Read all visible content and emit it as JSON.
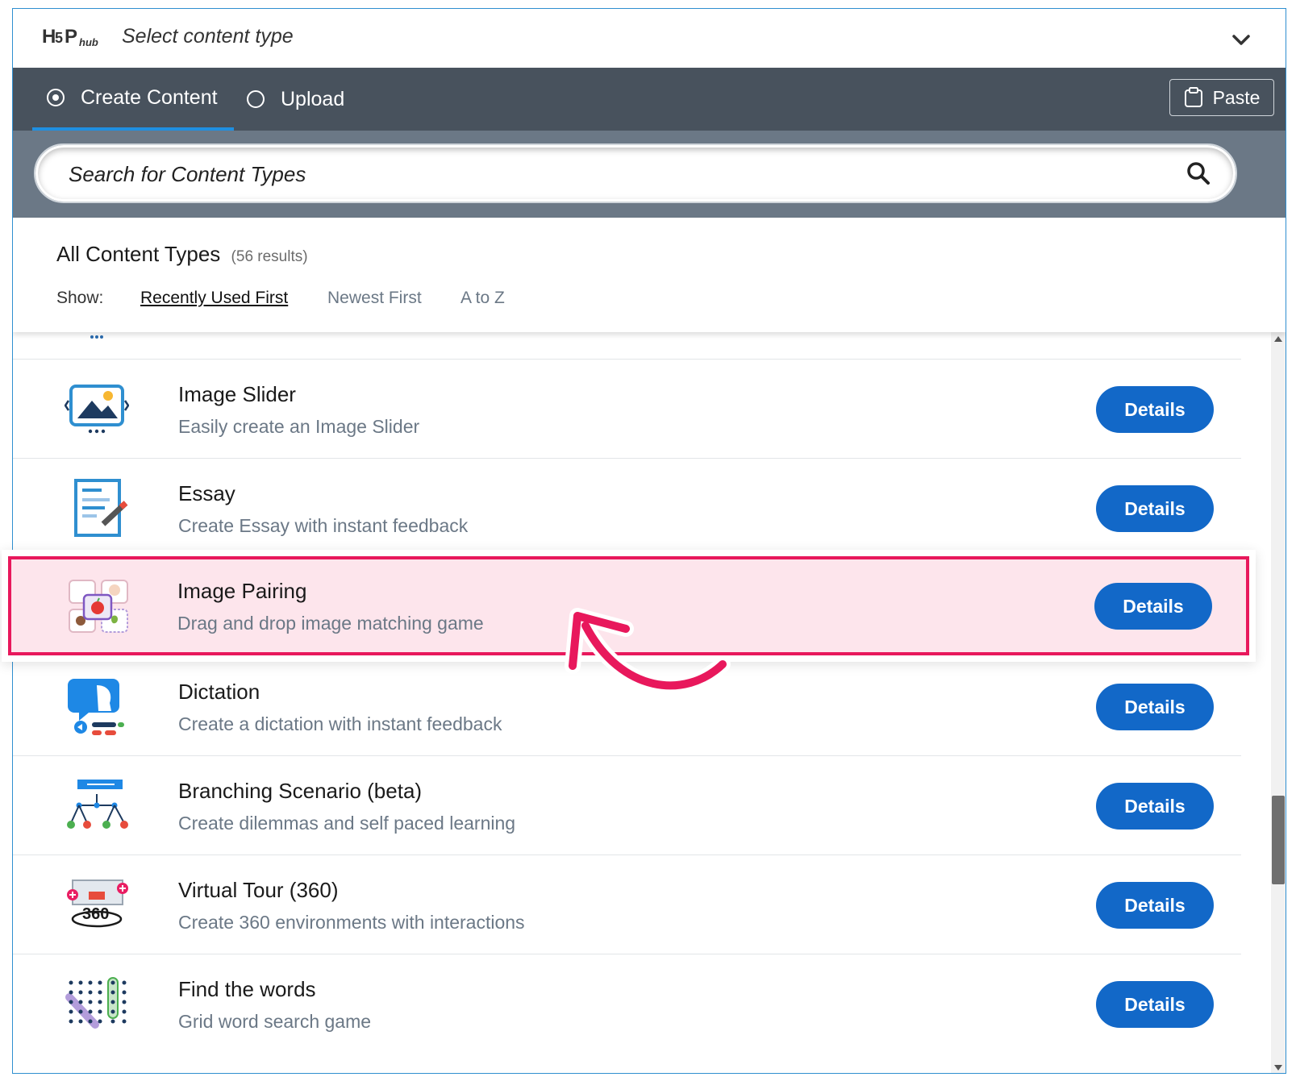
{
  "hub": {
    "title": "Select content type"
  },
  "tabs": [
    {
      "label": "Create Content",
      "selected": true
    },
    {
      "label": "Upload",
      "selected": false
    }
  ],
  "paste_label": "Paste",
  "search": {
    "placeholder": "Search for Content Types"
  },
  "list_header": {
    "title": "All Content Types",
    "count": "(56 results)",
    "show_label": "Show:",
    "sort_options": [
      "Recently Used First",
      "Newest First",
      "A to Z"
    ],
    "selected_sort": "Recently Used First"
  },
  "content_types": [
    {
      "title": "Image Slider",
      "description": "Easily create an Image Slider",
      "button": "Details",
      "icon": "image-slider-icon"
    },
    {
      "title": "Essay",
      "description": "Create Essay with instant feedback",
      "button": "Details",
      "icon": "essay-icon"
    },
    {
      "title": "Image Pairing",
      "description": "Drag and drop image matching game",
      "button": "Details",
      "icon": "image-pairing-icon",
      "highlighted": true
    },
    {
      "title": "Dictation",
      "description": "Create a dictation with instant feedback",
      "button": "Details",
      "icon": "dictation-icon"
    },
    {
      "title": "Branching Scenario (beta)",
      "description": "Create dilemmas and self paced learning",
      "button": "Details",
      "icon": "branching-scenario-icon"
    },
    {
      "title": "Virtual Tour (360)",
      "description": "Create 360 environments with interactions",
      "button": "Details",
      "icon": "virtual-tour-icon"
    },
    {
      "title": "Find the words",
      "description": "Grid word search game",
      "button": "Details",
      "icon": "find-the-words-icon"
    }
  ],
  "colors": {
    "tabbar": "#48525d",
    "search_area": "#6b7886",
    "details_button": "#1268c8",
    "highlight_border": "#e8185c",
    "highlight_fill": "#fde5ec"
  }
}
